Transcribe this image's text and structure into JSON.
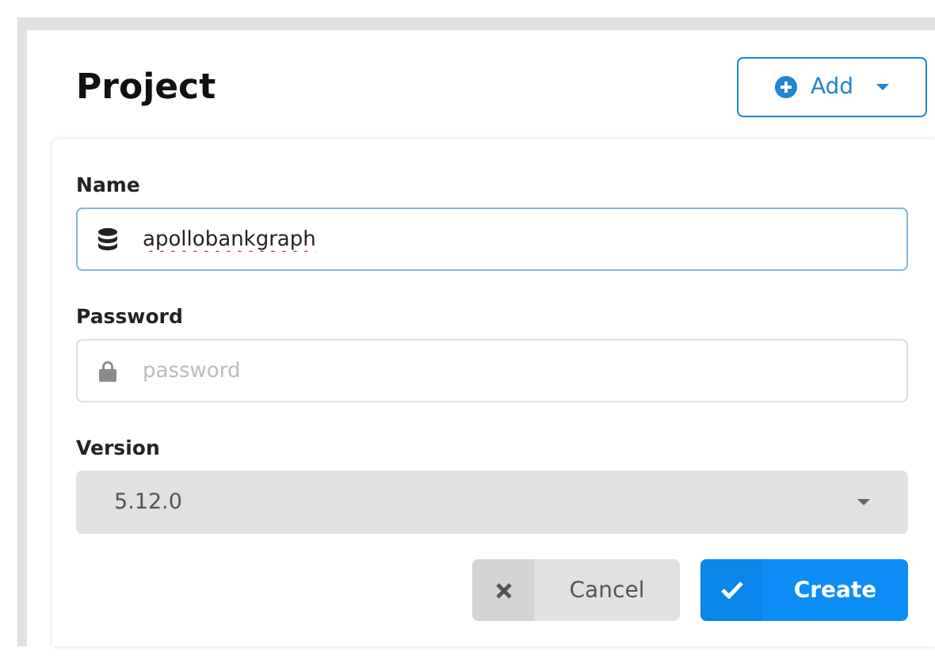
{
  "header": {
    "title": "Project",
    "add_button": "Add"
  },
  "fields": [
    {
      "kind": "text",
      "label": "Name",
      "value": "apollobankgraph",
      "focused": true
    },
    {
      "kind": "password",
      "label": "Password",
      "placeholder": "password",
      "focused": false
    },
    {
      "kind": "select",
      "label": "Version",
      "value": "5.12.0"
    }
  ],
  "buttons": [
    {
      "kind": "cancel",
      "label": "Cancel"
    },
    {
      "kind": "create",
      "label": "Create"
    }
  ]
}
